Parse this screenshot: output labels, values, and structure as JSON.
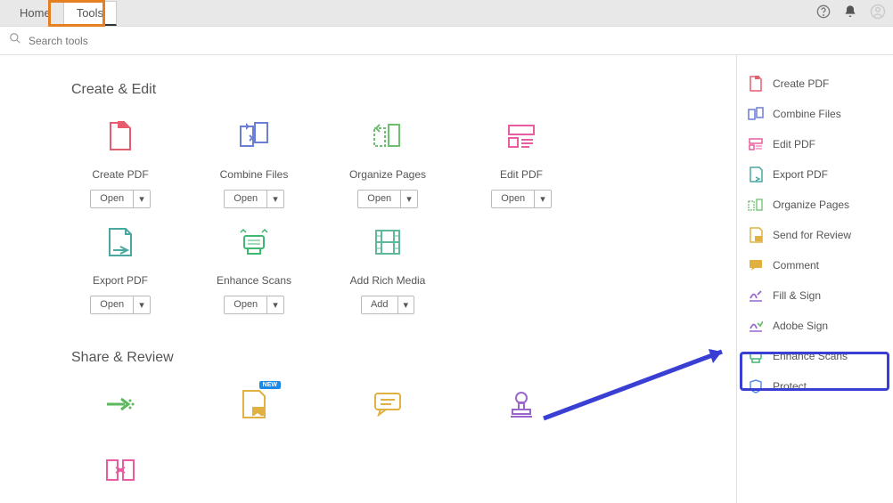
{
  "tabs": {
    "home": "Home",
    "tools": "Tools"
  },
  "search": {
    "placeholder": "Search tools"
  },
  "sections": {
    "create_edit": "Create & Edit",
    "share_review": "Share & Review"
  },
  "tools": {
    "create_pdf": {
      "label": "Create PDF",
      "btn": "Open"
    },
    "combine_files": {
      "label": "Combine Files",
      "btn": "Open"
    },
    "organize_pages": {
      "label": "Organize Pages",
      "btn": "Open"
    },
    "edit_pdf": {
      "label": "Edit PDF",
      "btn": "Open"
    },
    "export_pdf": {
      "label": "Export PDF",
      "btn": "Open"
    },
    "enhance_scans": {
      "label": "Enhance Scans",
      "btn": "Open"
    },
    "add_rich_media": {
      "label": "Add Rich Media",
      "btn": "Add"
    }
  },
  "badges": {
    "new": "NEW"
  },
  "dropdown_caret": "▾",
  "sidebar": {
    "items": [
      {
        "label": "Create PDF"
      },
      {
        "label": "Combine Files"
      },
      {
        "label": "Edit PDF"
      },
      {
        "label": "Export PDF"
      },
      {
        "label": "Organize Pages"
      },
      {
        "label": "Send for Review"
      },
      {
        "label": "Comment"
      },
      {
        "label": "Fill & Sign"
      },
      {
        "label": "Adobe Sign"
      },
      {
        "label": "Enhance Scans"
      },
      {
        "label": "Protect"
      }
    ]
  }
}
